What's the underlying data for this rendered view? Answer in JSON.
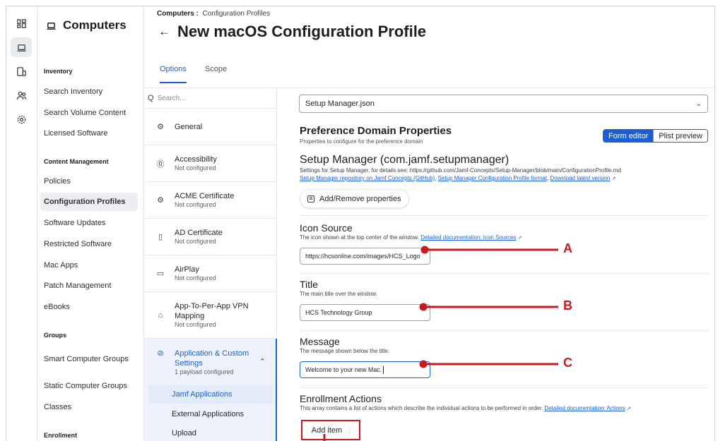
{
  "rail": {
    "icons": [
      "dashboard-icon",
      "computer-icon",
      "devices-icon",
      "users-icon",
      "settings-icon"
    ]
  },
  "sidebar": {
    "title": "Computers",
    "sections": {
      "inventory": "Inventory",
      "content": "Content Management",
      "groups": "Groups",
      "enrollment": "Enrollment"
    },
    "items": {
      "search_inventory": "Search Inventory",
      "search_volume": "Search Volume Content",
      "licensed": "Licensed Software",
      "policies": "Policies",
      "config_profiles": "Configuration Profiles",
      "software_updates": "Software Updates",
      "restricted": "Restricted Software",
      "mac_apps": "Mac Apps",
      "patch": "Patch Management",
      "ebooks": "eBooks",
      "smart_groups": "Smart Computer Groups",
      "static_groups": "Static Computer Groups",
      "classes": "Classes"
    }
  },
  "header": {
    "crumb_root": "Computers :",
    "crumb_leaf": "Configuration Profiles",
    "title": "New macOS Configuration Profile",
    "tabs": {
      "options": "Options",
      "scope": "Scope"
    }
  },
  "payloads": {
    "search_placeholder": "Search...",
    "items": [
      {
        "name": "General",
        "status": ""
      },
      {
        "name": "Accessibility",
        "status": "Not configured"
      },
      {
        "name": "ACME Certificate",
        "status": "Not configured"
      },
      {
        "name": "AD Certificate",
        "status": "Not configured"
      },
      {
        "name": "AirPlay",
        "status": "Not configured"
      },
      {
        "name": "App-To-Per-App VPN Mapping",
        "status": "Not configured"
      },
      {
        "name": "Application & Custom Settings",
        "status": "1 payload configured"
      }
    ],
    "sub_items": {
      "jamf": "Jamf Applications",
      "external": "External Applications",
      "upload": "Upload"
    }
  },
  "main": {
    "select_value": "Setup Manager.json",
    "pdp_title": "Preference Domain Properties",
    "pdp_sub": "Properties to configure for the preference domain",
    "toggle": {
      "form": "Form editor",
      "plist": "Plist preview"
    },
    "sm_title": "Setup Manager (com.jamf.setupmanager)",
    "sm_desc": "Settings for Setup Manager, for details see: https://github.com/Jamf-Concepts/Setup-Manager/blob/main/ConfigurationProfile.md",
    "sm_links": {
      "repo": "Setup Manager repository on Jamf Concepts (GitHub)",
      "format": "Setup Manager Configuration Profile format",
      "download": "Download latest version"
    },
    "add_remove": "Add/Remove properties",
    "icon_source": {
      "title": "Icon Source",
      "desc": "The icon shown at the top center of the window.",
      "doc_link": "Detailed documentation: Icon Sources",
      "value": "https://hcsonline.com/images/HCS_Logo"
    },
    "title_field": {
      "title": "Title",
      "desc": "The main title over the window.",
      "value": "HCS Technology Group"
    },
    "message": {
      "title": "Message",
      "desc": "The message shown below the title.",
      "value": "Welcome to your new Mac."
    },
    "enrollment": {
      "title": "Enrollment Actions",
      "desc": "This array contains a list of actions which describe the individual actions to be performed in order.",
      "doc_link": "Detailed documentation: Actions",
      "add_item": "Add item"
    }
  },
  "annotations": {
    "a": "A",
    "b": "B",
    "c": "C",
    "color": "#c8191e"
  }
}
